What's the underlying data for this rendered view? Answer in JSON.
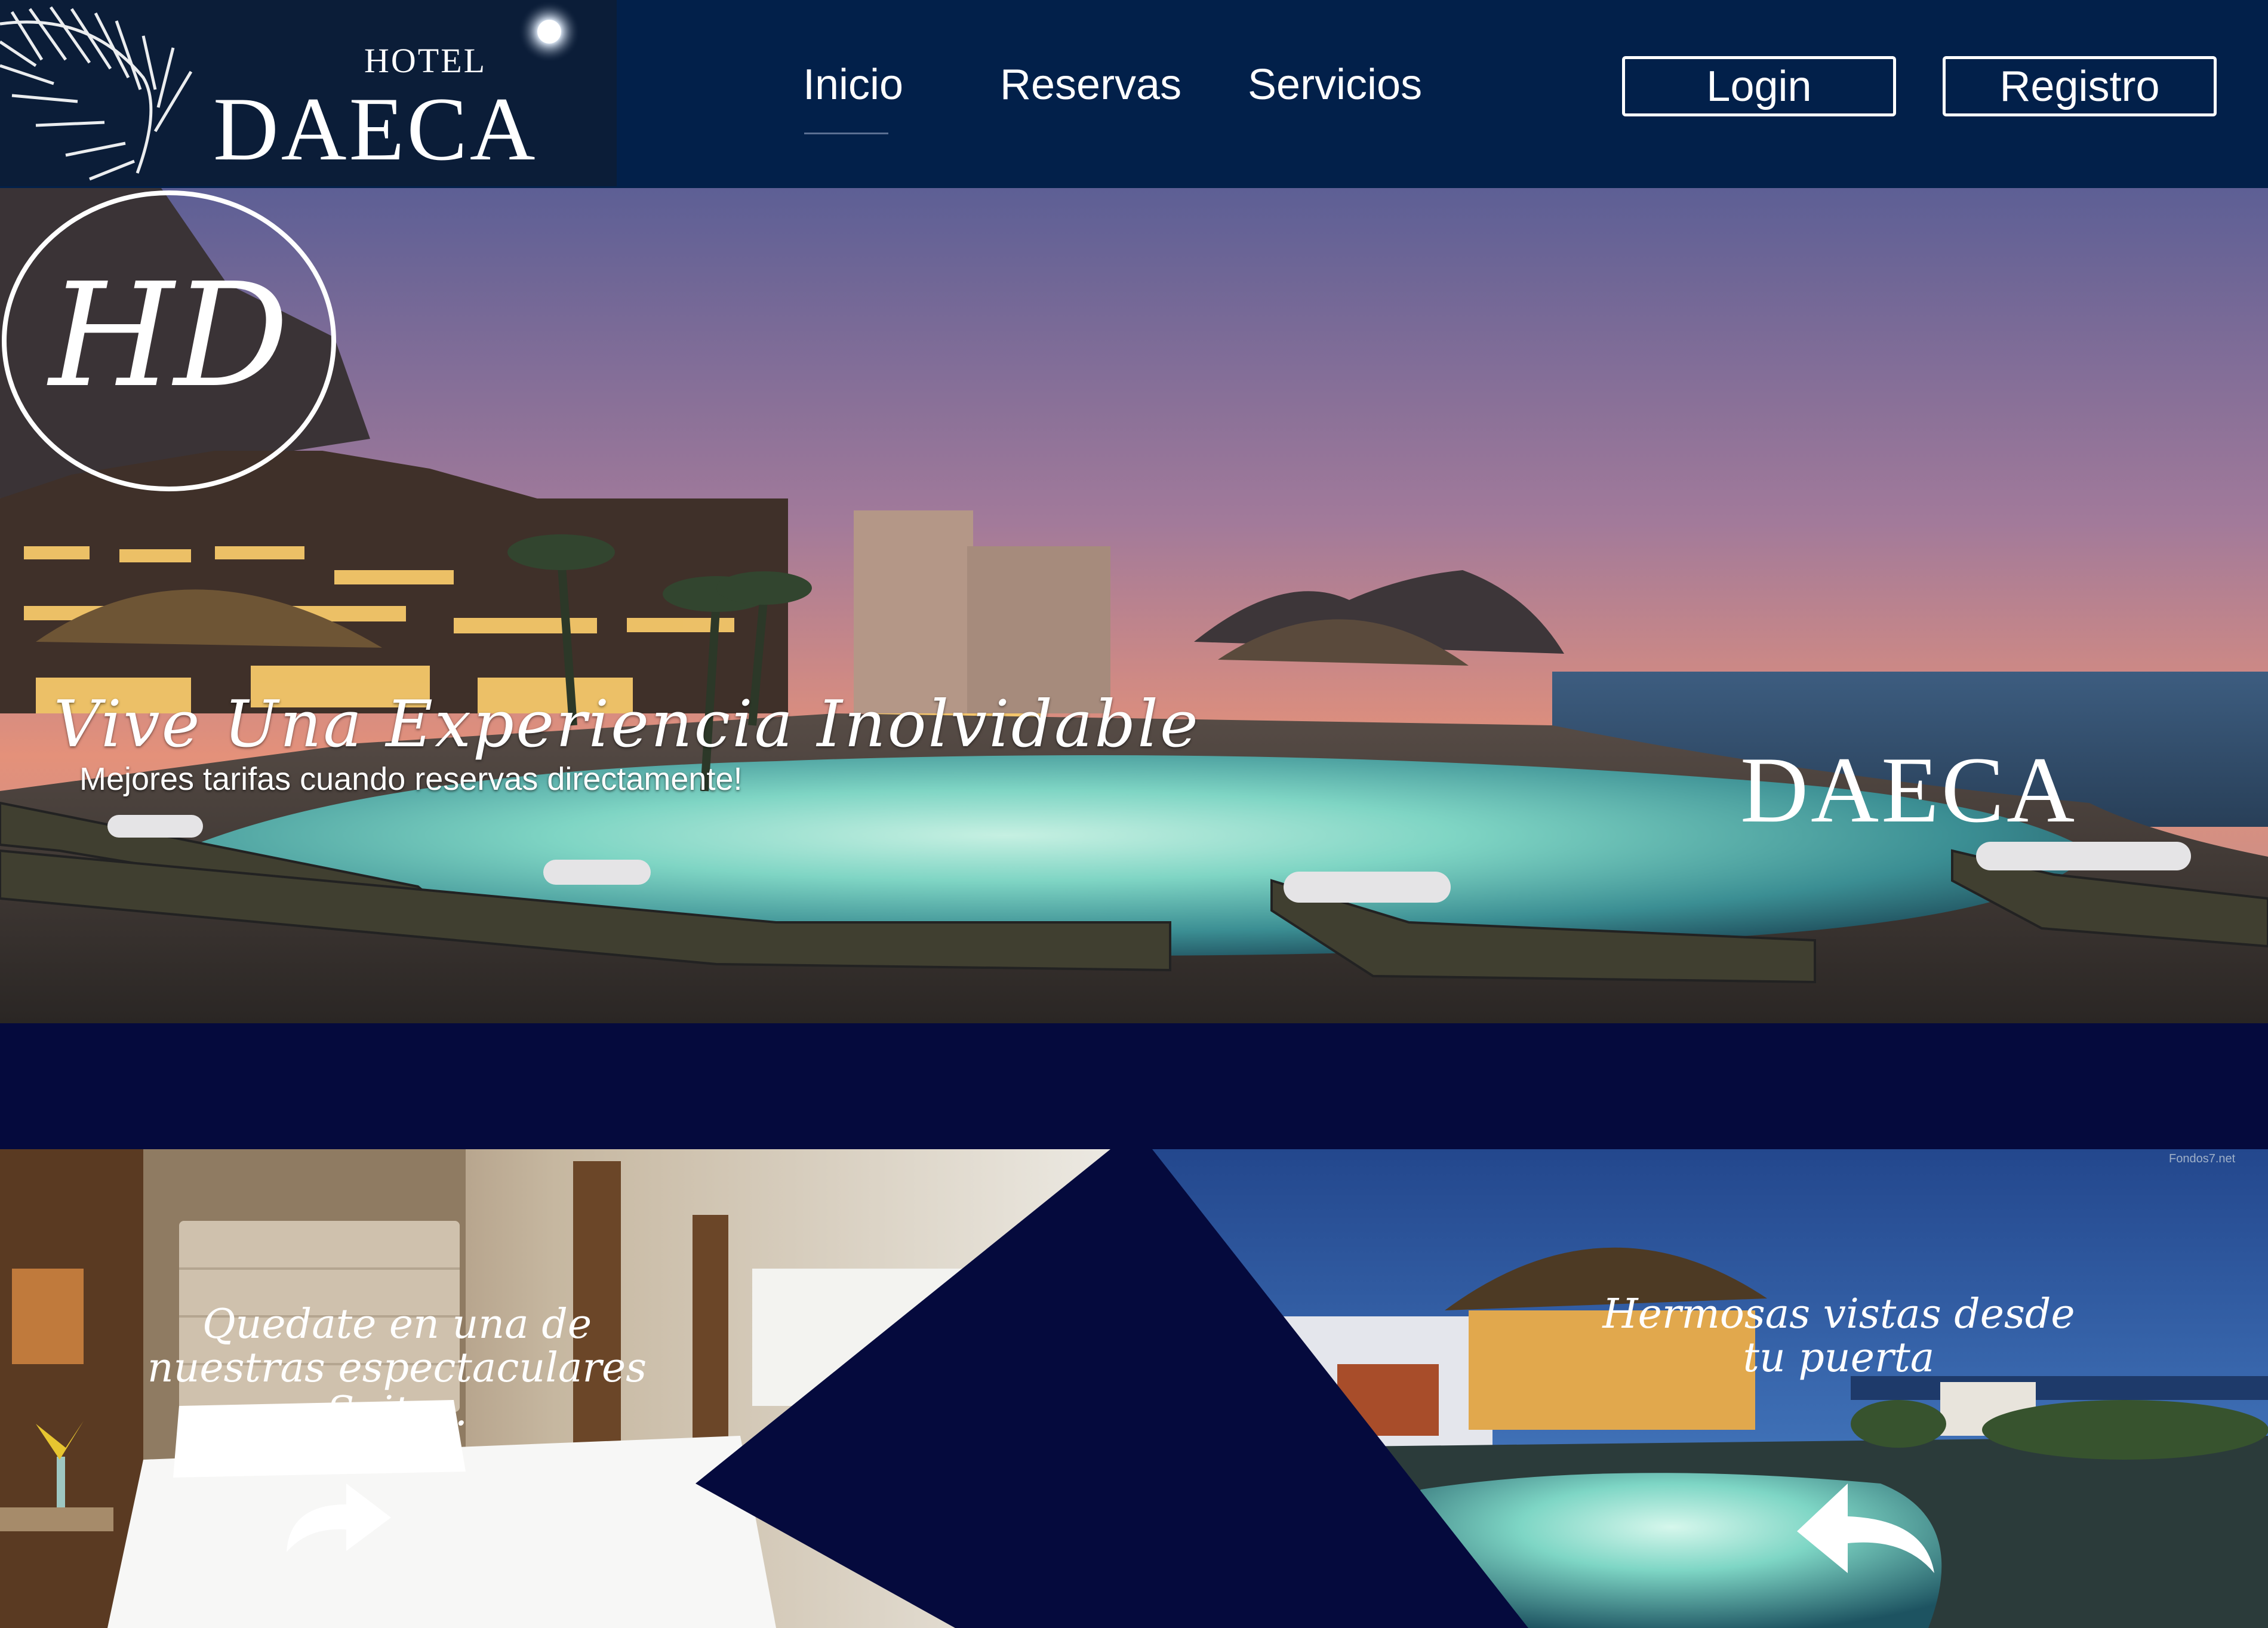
{
  "header": {
    "logo": {
      "hotel_text": "HOTEL",
      "name_text": "DAECA"
    },
    "nav": [
      {
        "label": "Inicio",
        "active": true
      },
      {
        "label": "Reservas",
        "active": false
      },
      {
        "label": "Servicios",
        "active": false
      }
    ],
    "login_label": "Login",
    "register_label": "Registro"
  },
  "hero": {
    "title": "Vive  Una Experiencia Inolvidable",
    "subtitle": "Mejores tarifas cuando reservas directamente!",
    "emblem_monogram": "HD",
    "emblem_name": "DAECA"
  },
  "promos": {
    "left_caption": "Quedate en una de nuestras espectaculares Suites.",
    "right_caption": "Hermosas vistas desde tu puerta",
    "watermark": "Fondos7.net"
  },
  "colors": {
    "header_bg": "#02204a",
    "logo_bg": "#0b1d38",
    "band_bg": "#050a3d",
    "text": "#ffffff"
  }
}
